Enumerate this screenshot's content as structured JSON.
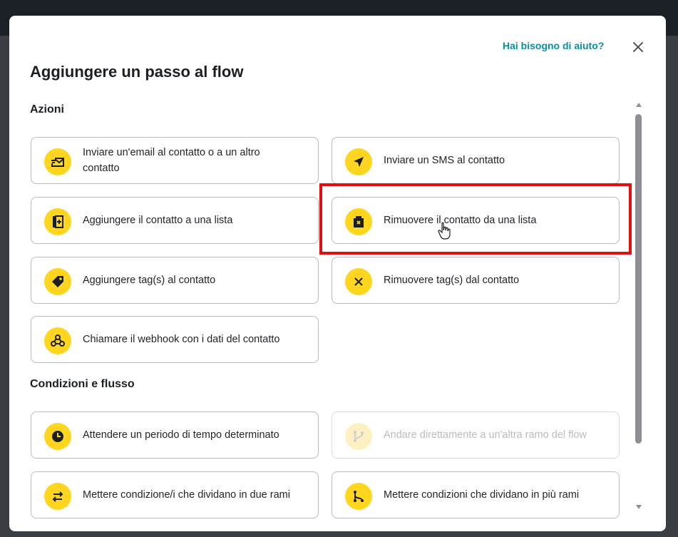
{
  "modal": {
    "help_link": "Hai bisogno di aiuto?",
    "title": "Aggiungere un passo al flow",
    "close_icon": "close-icon"
  },
  "sections": {
    "actions": {
      "title": "Azioni",
      "items": [
        {
          "label": "Inviare un'email al contatto o a un altro contatto",
          "icon": "email-send-icon"
        },
        {
          "label": "Inviare un SMS al contatto",
          "icon": "paper-plane-icon"
        },
        {
          "label": "Aggiungere il contatto a una lista",
          "icon": "list-add-icon"
        },
        {
          "label": "Rimuovere il contatto da una lista",
          "icon": "list-remove-icon"
        },
        {
          "label": "Aggiungere tag(s) al contatto",
          "icon": "tag-icon"
        },
        {
          "label": "Rimuovere tag(s) dal contatto",
          "icon": "x-icon"
        },
        {
          "label": "Chiamare il webhook con i dati del contatto",
          "icon": "webhook-icon"
        }
      ]
    },
    "conditions": {
      "title": "Condizioni e flusso",
      "items": [
        {
          "label": "Attendere un periodo di tempo determinato",
          "icon": "clock-icon"
        },
        {
          "label": "Andare direttamente a un'altra ramo del flow",
          "icon": "branch-icon",
          "disabled": true
        },
        {
          "label": "Mettere condizione/i che dividano in due rami",
          "icon": "arrows-swap-icon"
        },
        {
          "label": "Mettere condizioni che dividano in più rami",
          "icon": "multi-branch-icon"
        }
      ]
    }
  },
  "colors": {
    "accent_yellow": "#ffd51f",
    "link_teal": "#0b8fa0",
    "highlight_red": "#e01010"
  }
}
